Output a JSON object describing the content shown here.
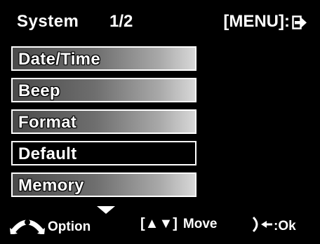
{
  "header": {
    "title": "System",
    "page_indicator": "1/2",
    "menu_hint": "[MENU]:"
  },
  "menu": {
    "items": [
      {
        "label": "Date/Time",
        "selected": false
      },
      {
        "label": "Beep",
        "selected": false
      },
      {
        "label": "Format",
        "selected": false
      },
      {
        "label": "Default",
        "selected": true
      },
      {
        "label": "Memory",
        "selected": false
      }
    ]
  },
  "footer": {
    "option_label": "Option",
    "move_brackets": "[▲▼]",
    "move_label": "Move",
    "ok_label": ":Ok"
  },
  "icons": {
    "exit": "exit-arrow-icon",
    "more_below": "down-arrow-icon",
    "option": "zoom-lever-icon",
    "ok": "shutter-button-icon"
  },
  "colors": {
    "background": "#000000",
    "text": "#ffffff",
    "item_gradient_start": "#4a4a4a",
    "item_gradient_end": "#d8d8d8",
    "selected_background": "#000000"
  }
}
